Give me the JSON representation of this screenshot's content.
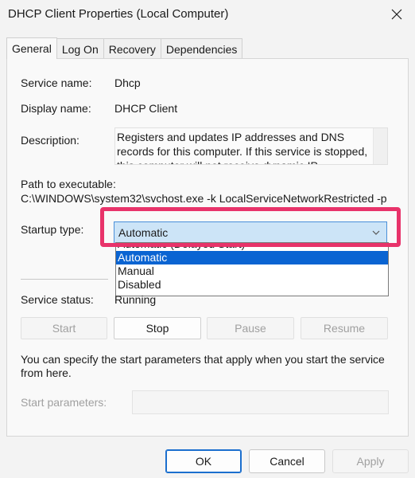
{
  "window": {
    "title": "DHCP Client Properties (Local Computer)"
  },
  "tabs": [
    {
      "label": "General"
    },
    {
      "label": "Log On"
    },
    {
      "label": "Recovery"
    },
    {
      "label": "Dependencies"
    }
  ],
  "general": {
    "service_name_label": "Service name:",
    "service_name_value": "Dhcp",
    "display_name_label": "Display name:",
    "display_name_value": "DHCP Client",
    "description_label": "Description:",
    "description_value": "Registers and updates IP addresses and DNS records for this computer. If this service is stopped, this computer will not receive dynamic IP addresses",
    "path_label": "Path to executable:",
    "path_value": "C:\\WINDOWS\\system32\\svchost.exe -k LocalServiceNetworkRestricted -p",
    "startup_label": "Startup type:",
    "startup_value": "Automatic",
    "startup_options": [
      "Automatic (Delayed Start)",
      "Automatic",
      "Manual",
      "Disabled"
    ],
    "status_label": "Service status:",
    "status_value": "Running",
    "start_label": "Start",
    "stop_label": "Stop",
    "pause_label": "Pause",
    "resume_label": "Resume",
    "params_help": "You can specify the start parameters that apply when you start the service from here.",
    "params_label": "Start parameters:"
  },
  "footer": {
    "ok_label": "OK",
    "cancel_label": "Cancel",
    "apply_label": "Apply"
  },
  "colors": {
    "highlight": "#e8336a",
    "selected_option": "#0a64d2",
    "dropdown_bg": "#cce4f7"
  }
}
